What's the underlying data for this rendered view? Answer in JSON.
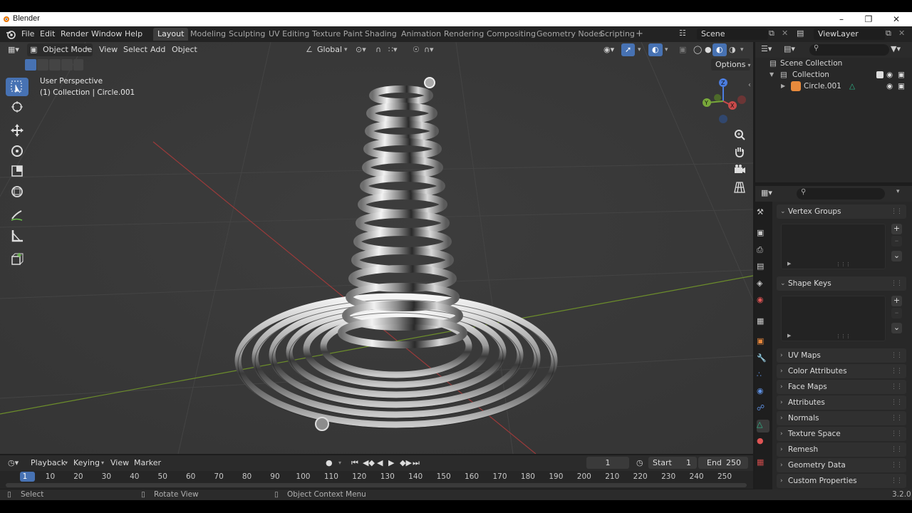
{
  "window": {
    "app_title": "Blender"
  },
  "menu": [
    "File",
    "Edit",
    "Render",
    "Window",
    "Help"
  ],
  "workspaces": [
    "Layout",
    "Modeling",
    "Sculpting",
    "UV Editing",
    "Texture Paint",
    "Shading",
    "Animation",
    "Rendering",
    "Compositing",
    "Geometry Nodes",
    "Scripting"
  ],
  "active_workspace": "Layout",
  "scene": {
    "label": "Scene",
    "view_layer": "ViewLayer"
  },
  "viewport": {
    "mode": "Object Mode",
    "menus": [
      "View",
      "Select",
      "Add",
      "Object"
    ],
    "orientation": "Global",
    "options_label": "Options",
    "overlay_title": "User Perspective",
    "overlay_subtitle": "(1) Collection | Circle.001"
  },
  "outliner": {
    "root": "Scene Collection",
    "collection": "Collection",
    "object": "Circle.001"
  },
  "properties": {
    "panels_open": [
      "Vertex Groups",
      "Shape Keys"
    ],
    "panels_closed": [
      "UV Maps",
      "Color Attributes",
      "Face Maps",
      "Attributes",
      "Normals",
      "Texture Space",
      "Remesh",
      "Geometry Data",
      "Custom Properties"
    ]
  },
  "timeline": {
    "menus": [
      "Playback",
      "Keying",
      "View",
      "Marker"
    ],
    "current_frame": "1",
    "start_label": "Start",
    "start": "1",
    "end_label": "End",
    "end": "250",
    "ruler": [
      "1",
      "10",
      "20",
      "30",
      "40",
      "50",
      "60",
      "70",
      "80",
      "90",
      "100",
      "110",
      "120",
      "130",
      "140",
      "150",
      "160",
      "170",
      "180",
      "190",
      "200",
      "210",
      "220",
      "230",
      "240",
      "250"
    ]
  },
  "status": {
    "select": "Select",
    "rotate": "Rotate View",
    "context": "Object Context Menu",
    "version": "3.2.0"
  },
  "colors": {
    "accent": "#4772b3",
    "header": "#232323",
    "viewport_bg": "#3a3a3a",
    "x_axis": "#a33b3b",
    "y_axis": "#6a8a2a"
  }
}
